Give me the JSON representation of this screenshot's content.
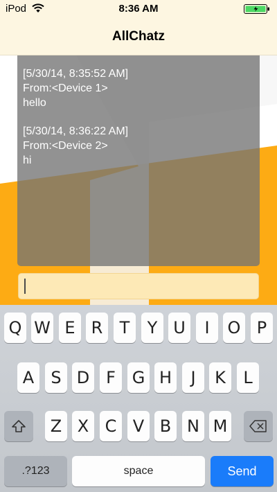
{
  "status_bar": {
    "carrier": "iPod",
    "time": "8:36 AM"
  },
  "nav": {
    "title": "AllChatz"
  },
  "chat": {
    "messages": [
      {
        "timestamp": "[5/30/14, 8:35:52 AM]",
        "from": "From:<Device 1>",
        "text": "hello"
      },
      {
        "timestamp": "[5/30/14, 8:36:22 AM]",
        "from": "From:<Device 2>",
        "text": "hi"
      }
    ]
  },
  "input": {
    "value": "",
    "placeholder": ""
  },
  "keyboard": {
    "row1": [
      "Q",
      "W",
      "E",
      "R",
      "T",
      "Y",
      "U",
      "I",
      "O",
      "P"
    ],
    "row2": [
      "A",
      "S",
      "D",
      "F",
      "G",
      "H",
      "J",
      "K",
      "L"
    ],
    "row3": [
      "Z",
      "X",
      "C",
      "V",
      "B",
      "N",
      "M"
    ],
    "numbers_label": ".?123",
    "space_label": "space",
    "send_label": "Send",
    "shift_icon": "shift-icon",
    "delete_icon": "delete-icon"
  },
  "colors": {
    "accent": "#1a7cfa",
    "background_orange": "#fdab14",
    "nav_background": "#fdf6e1",
    "input_background": "#fde9b6",
    "chat_panel": "#737373"
  }
}
